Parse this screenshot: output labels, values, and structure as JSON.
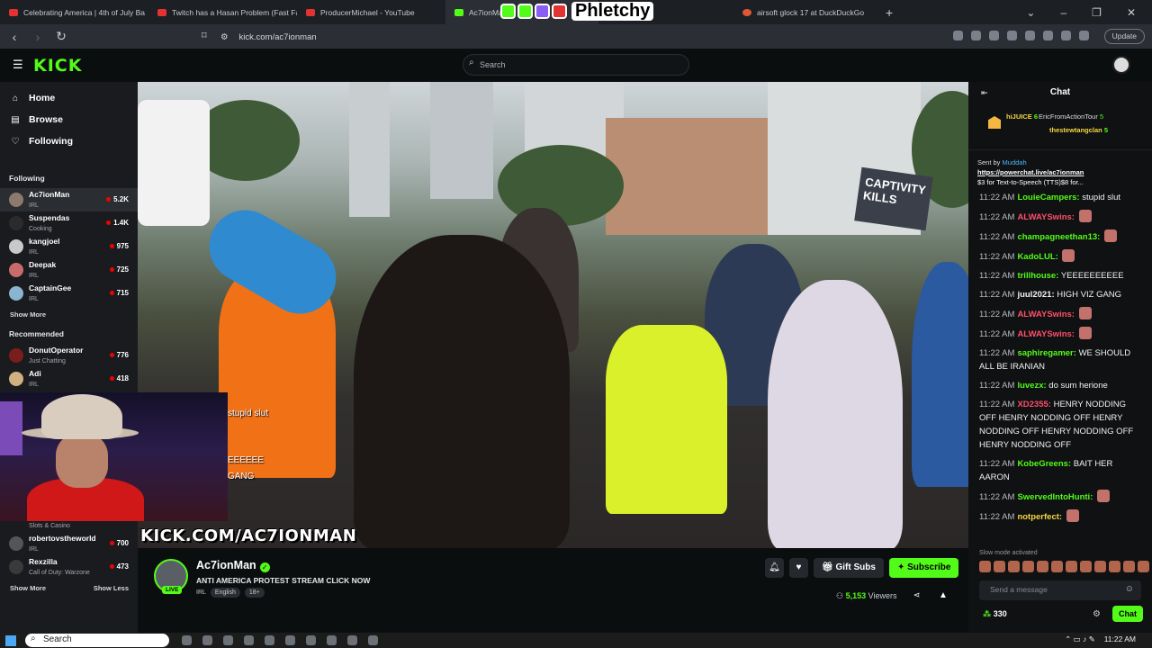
{
  "browser": {
    "tabs": [
      {
        "label": "Celebrating America | 4th of July Ba"
      },
      {
        "label": "Twitch has a Hasan Problem (Fast Fa"
      },
      {
        "label": "ProducerMichael - YouTube"
      },
      {
        "label": "Ac7ionMan"
      },
      {
        "label": "airsoft glock 17 at DuckDuckGo"
      }
    ],
    "url": "kick.com/ac7ionman",
    "update_label": "Update",
    "overlay_brand": "Phletchy"
  },
  "site": {
    "logo": "KICK",
    "search_placeholder": "Search"
  },
  "sidebar": {
    "nav": [
      {
        "icon": "home-icon",
        "glyph": "⌂",
        "label": "Home"
      },
      {
        "icon": "browse-icon",
        "glyph": "▤",
        "label": "Browse"
      },
      {
        "icon": "heart-icon",
        "glyph": "♡",
        "label": "Following"
      }
    ],
    "following_header": "Following",
    "following": [
      {
        "name": "Ac7ionMan",
        "cat": "IRL",
        "count": "5.2K"
      },
      {
        "name": "Suspendas",
        "cat": "Cooking",
        "count": "1.4K"
      },
      {
        "name": "kangjoel",
        "cat": "IRL",
        "count": "975"
      },
      {
        "name": "Deepak",
        "cat": "IRL",
        "count": "725"
      },
      {
        "name": "CaptainGee",
        "cat": "IRL",
        "count": "715"
      }
    ],
    "show_more": "Show More",
    "recommended_header": "Recommended",
    "recommended": [
      {
        "name": "DonutOperator",
        "cat": "Just Chatting",
        "count": "776"
      },
      {
        "name": "Adi",
        "cat": "IRL",
        "count": "418"
      }
    ],
    "partial_cat": "Slots & Casino",
    "bottom": [
      {
        "name": "robertovstheworld",
        "cat": "IRL",
        "count": "700"
      },
      {
        "name": "Rexzilla",
        "cat": "Call of Duty: Warzone",
        "count": "473"
      }
    ],
    "show_more_2": "Show More",
    "show_less": "Show Less"
  },
  "video": {
    "sign_text": "CAPTIVITY KILLS",
    "overlay_lines": [
      "stupid slut",
      "EEEEEE",
      "GANG"
    ],
    "url_watermark": "KICK.COM/AC7IONMAN"
  },
  "stream": {
    "live": "LIVE",
    "name": "Ac7ionMan",
    "title": "ANTI AMERICA PROTEST STREAM CLICK NOW",
    "category": "IRL",
    "language": "English",
    "rating": "18+",
    "gift_label": "Gift Subs",
    "subscribe_label": "Subscribe",
    "viewers_count": "5,153",
    "viewers_label": "Viewers"
  },
  "chat": {
    "title": "Chat",
    "pinned": {
      "user1": "hiJUICE",
      "n1": "6",
      "user2": "EricFromActionTour",
      "n2": "5",
      "user3": "thestewtangclan",
      "n3": "5"
    },
    "sent_by": "Sent by",
    "sent_by_user": "Muddah",
    "link": "https://powerchat.live/ac7ionman",
    "link_desc": "$3 for Text-to-Speech (TTS)$8 for...",
    "messages": [
      {
        "t": "11:22 AM",
        "u": "LouieCampers:",
        "c": "#53fc18",
        "m": "stupid slut"
      },
      {
        "t": "11:22 AM",
        "u": "ALWAYSwins:",
        "c": "#ff4f6a",
        "m": ""
      },
      {
        "t": "11:22 AM",
        "u": "champagneethan13:",
        "c": "#53fc18",
        "m": ""
      },
      {
        "t": "11:22 AM",
        "u": "KadoLUL:",
        "c": "#53fc18",
        "m": ""
      },
      {
        "t": "11:22 AM",
        "u": "trillhouse:",
        "c": "#53fc18",
        "m": "YEEEEEEEEEE"
      },
      {
        "t": "11:22 AM",
        "u": "juul2021:",
        "c": "#f0f2f4",
        "m": "HIGH VIZ GANG"
      },
      {
        "t": "11:22 AM",
        "u": "ALWAYSwins:",
        "c": "#ff4f6a",
        "m": ""
      },
      {
        "t": "11:22 AM",
        "u": "ALWAYSwins:",
        "c": "#ff4f6a",
        "m": ""
      },
      {
        "t": "11:22 AM",
        "u": "saphiregamer:",
        "c": "#53fc18",
        "m": "WE SHOULD ALL BE IRANIAN"
      },
      {
        "t": "11:22 AM",
        "u": "luvezx:",
        "c": "#53fc18",
        "m": "do sum herione"
      },
      {
        "t": "11:22 AM",
        "u": "XD2355:",
        "c": "#ff4f6a",
        "m": "HENRY NODDING OFF HENRY NODDING OFF HENRY NODDING OFF HENRY NODDING OFF HENRY NODDING OFF"
      },
      {
        "t": "11:22 AM",
        "u": "KobeGreens:",
        "c": "#53fc18",
        "m": "BAIT HER AARON"
      },
      {
        "t": "11:22 AM",
        "u": "SwervedIntoHunti:",
        "c": "#53fc18",
        "m": ""
      },
      {
        "t": "11:22 AM",
        "u": "notperfect:",
        "c": "#f5d742",
        "m": ""
      }
    ],
    "slow_mode": "Slow mode activated",
    "input_placeholder": "Send a message",
    "points": "330",
    "chat_button": "Chat"
  },
  "taskbar": {
    "search": "Search",
    "time": "11:22 AM"
  }
}
